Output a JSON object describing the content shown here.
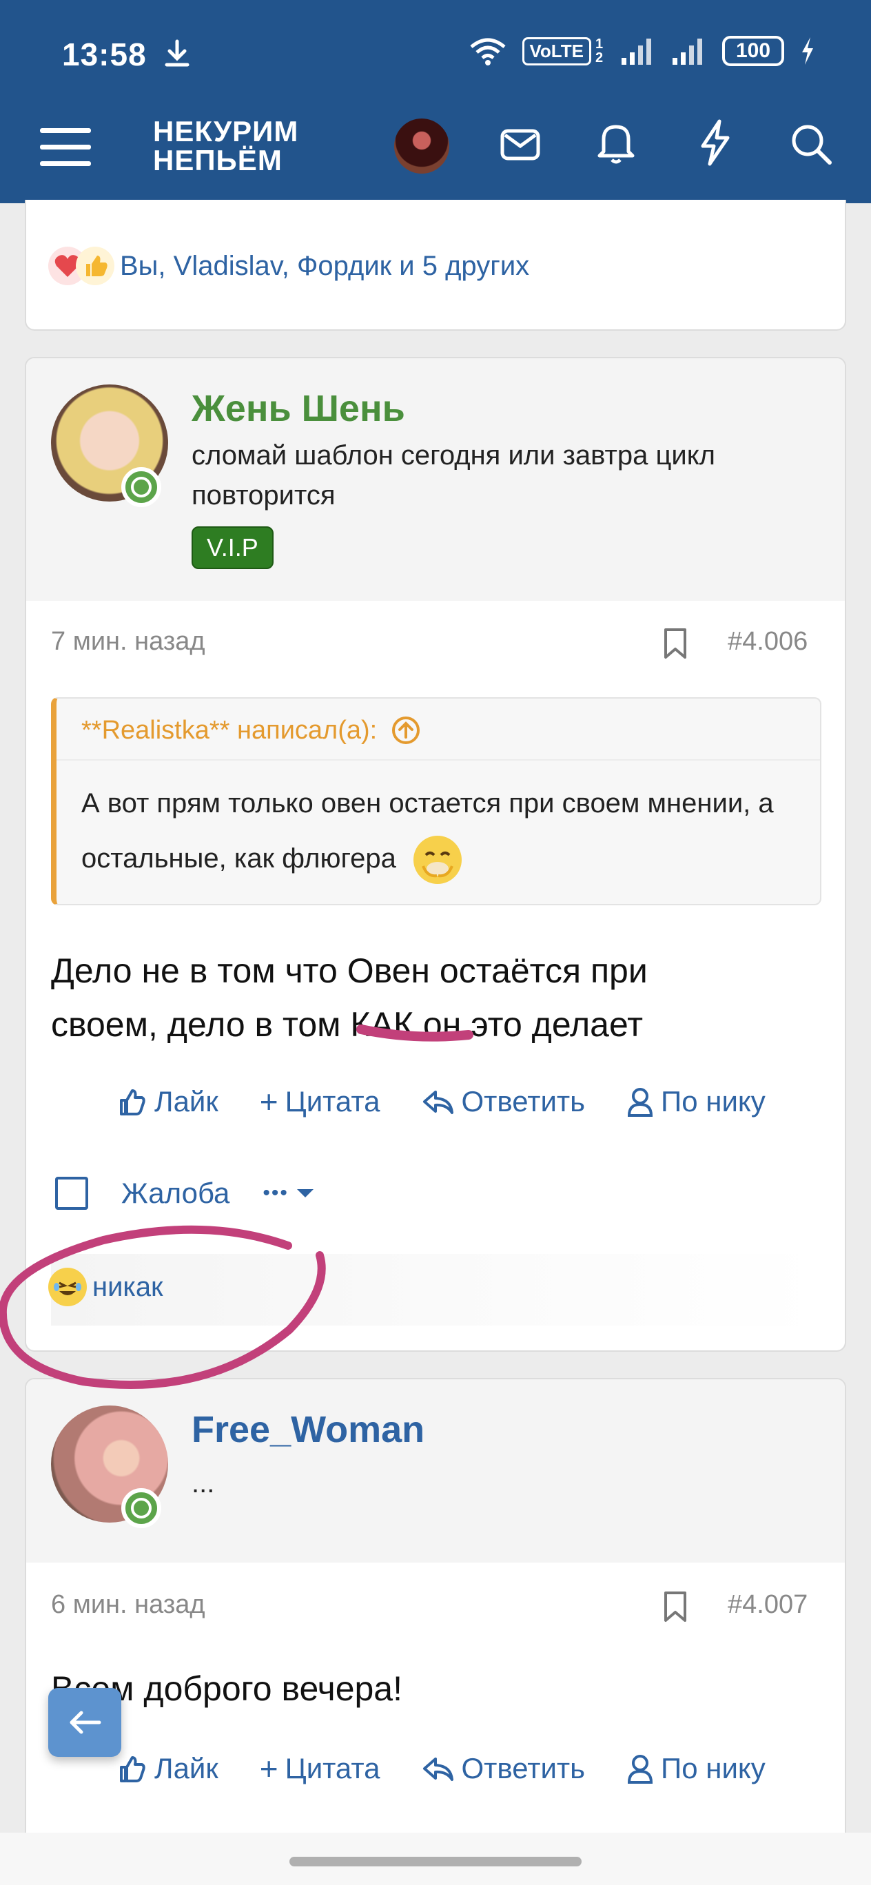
{
  "status_bar": {
    "time": "13:58",
    "volte": "VoLTE",
    "sim": "1 2",
    "battery": "100"
  },
  "header": {
    "logo_line1": "НЕКУРИМ",
    "logo_line2": "НЕПЬЁМ"
  },
  "prev_post": {
    "reactions_text": "Вы, Vladislav, Фордик и 5 других"
  },
  "post1": {
    "username": "Жень Шень",
    "user_title": "сломай шаблон сегодня или завтра цикл повторится",
    "badge": "V.I.P",
    "time": "7 мин. назад",
    "number": "#4.006",
    "quote_author": "**Realistka** написал(а):",
    "quote_text": "А вот прям только овен остается при своем мнении, а остальные, как флюгера",
    "text_line1": "Дело не в том что Овен остаётся при",
    "text_line2_a": "своем, дело в том ",
    "text_line2_b": "КАК",
    "text_line2_c": " он это делает",
    "actions": {
      "like": "Лайк",
      "quote": "Цитата",
      "reply": "Ответить",
      "by_nick": "По нику",
      "report": "Жалоба",
      "more": "•••"
    },
    "reaction_text": "никак"
  },
  "post2": {
    "username": "Free_Woman",
    "user_title": "...",
    "time": "6 мин. назад",
    "number": "#4.007",
    "text": "Всем доброго вечера!",
    "actions": {
      "like": "Лайк",
      "quote": "Цитата",
      "reply": "Ответить",
      "by_nick": "По нику"
    }
  },
  "colors": {
    "header_bg": "#22548c",
    "link": "#2e63a3",
    "username_green": "#4a8f3c",
    "username_blue": "#2e63a3",
    "quote_accent": "#e9a23b",
    "vip_green": "#2e7d22",
    "annotation": "#c2407a"
  }
}
